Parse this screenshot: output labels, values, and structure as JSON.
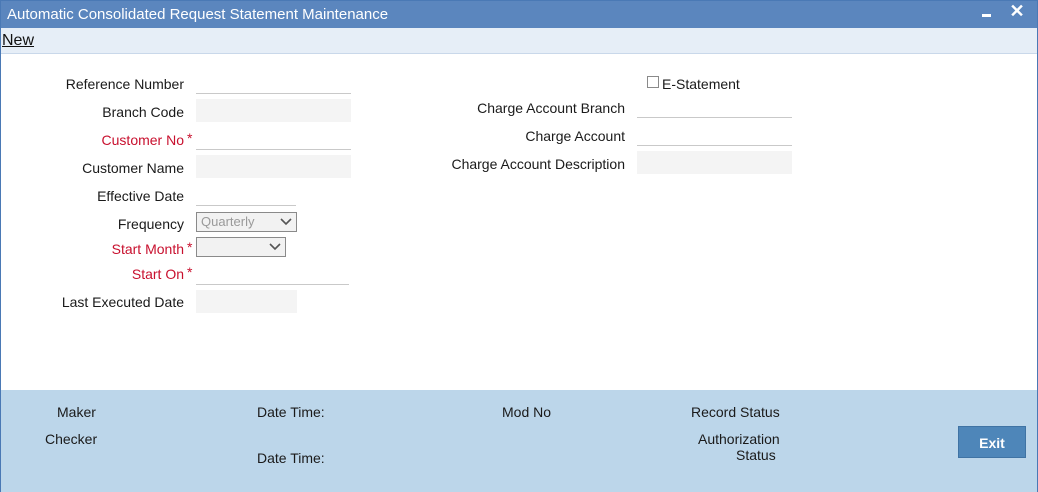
{
  "window": {
    "title": "Automatic Consolidated Request Statement Maintenance",
    "close_glyph": "✕"
  },
  "toolbar": {
    "new_label": "New"
  },
  "left_form": {
    "reference_number": {
      "label": "Reference Number",
      "value": ""
    },
    "branch_code": {
      "label": "Branch Code",
      "value": ""
    },
    "customer_no": {
      "label": "Customer No",
      "value": "",
      "required": "*"
    },
    "customer_name": {
      "label": "Customer Name",
      "value": ""
    },
    "effective_date": {
      "label": "Effective Date",
      "value": ""
    },
    "frequency": {
      "label": "Frequency",
      "selected": "Quarterly"
    },
    "start_month": {
      "label": "Start Month",
      "selected": "",
      "required": "*"
    },
    "start_on": {
      "label": "Start On",
      "value": "",
      "required": "*"
    },
    "last_executed_date": {
      "label": "Last Executed Date",
      "value": ""
    }
  },
  "right_form": {
    "e_statement": {
      "label": "E-Statement",
      "checked": false
    },
    "charge_account_branch": {
      "label": "Charge Account Branch",
      "value": ""
    },
    "charge_account": {
      "label": "Charge Account",
      "value": ""
    },
    "charge_account_description": {
      "label": "Charge Account Description",
      "value": ""
    }
  },
  "footer": {
    "maker": "Maker",
    "date_time_1": "Date Time:",
    "mod_no": "Mod No",
    "record_status": "Record Status",
    "checker": "Checker",
    "date_time_2": "Date Time:",
    "authorization_status_line1": "Authorization",
    "authorization_status_line2": "Status",
    "exit_label": "Exit"
  },
  "colors": {
    "titlebar": "#5b86be",
    "required_label": "#c8102e",
    "footer_bg": "#bcd6ea",
    "exit_button": "#4e86b9"
  }
}
